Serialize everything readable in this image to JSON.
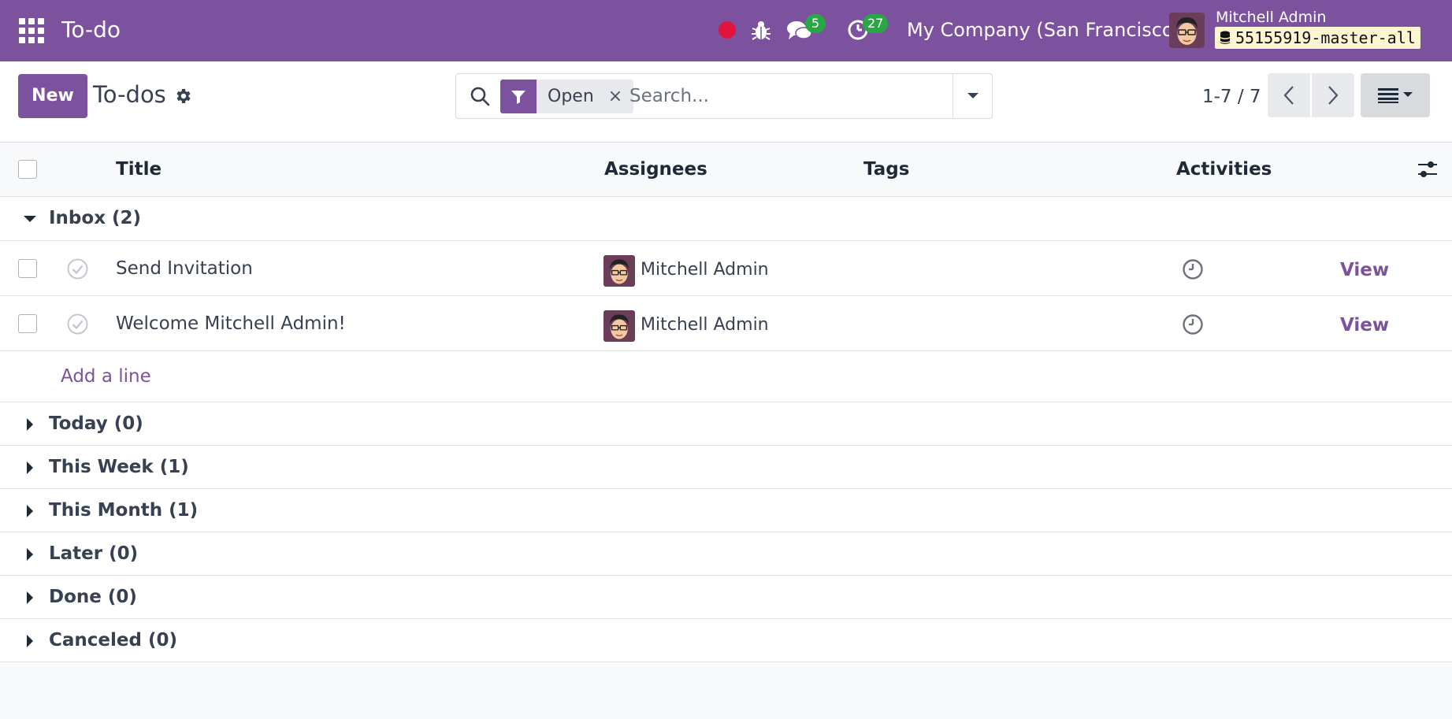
{
  "navbar": {
    "app_title": "To-do",
    "chat_count": "5",
    "activity_count": "27",
    "company": "My Company (San Francisco)",
    "user_name": "Mitchell Admin",
    "database": "55155919-master-all",
    "bg_color": "#7c529f"
  },
  "control": {
    "new_label": "New",
    "breadcrumb": "To-dos",
    "search": {
      "facet_label": "Open",
      "facet_remove": "×",
      "placeholder": "Search..."
    },
    "pager": "1-7 / 7"
  },
  "list": {
    "columns": {
      "title": "Title",
      "assignees": "Assignees",
      "tags": "Tags",
      "activities": "Activities"
    },
    "groups": [
      {
        "label": "Inbox (2)",
        "expanded": true
      },
      {
        "label": "Today (0)",
        "expanded": false
      },
      {
        "label": "This Week (1)",
        "expanded": false
      },
      {
        "label": "This Month (1)",
        "expanded": false
      },
      {
        "label": "Later (0)",
        "expanded": false
      },
      {
        "label": "Done (0)",
        "expanded": false
      },
      {
        "label": "Canceled (0)",
        "expanded": false
      }
    ],
    "records": [
      {
        "title": "Send Invitation",
        "assignee": "Mitchell Admin",
        "action": "View"
      },
      {
        "title": "Welcome Mitchell Admin!",
        "assignee": "Mitchell Admin",
        "action": "View"
      }
    ],
    "add_line": "Add a line"
  },
  "icons": {
    "apps": "apps-grid-icon",
    "recording": "recording-dot-icon",
    "debug": "bug-icon",
    "messages": "chat-icon",
    "activities": "clock-icon",
    "database": "database-icon",
    "settings": "gear-icon",
    "search": "search-icon",
    "filter": "filter-icon",
    "dropdown": "caret-down-icon",
    "prev": "chevron-left-icon",
    "next": "chevron-right-icon",
    "list_view": "list-view-icon",
    "optional_columns": "sliders-icon"
  },
  "colors": {
    "primary": "#7c529f",
    "badge": "#28a745",
    "recording": "#e0143c",
    "db_pill": "#fdf6d0"
  }
}
